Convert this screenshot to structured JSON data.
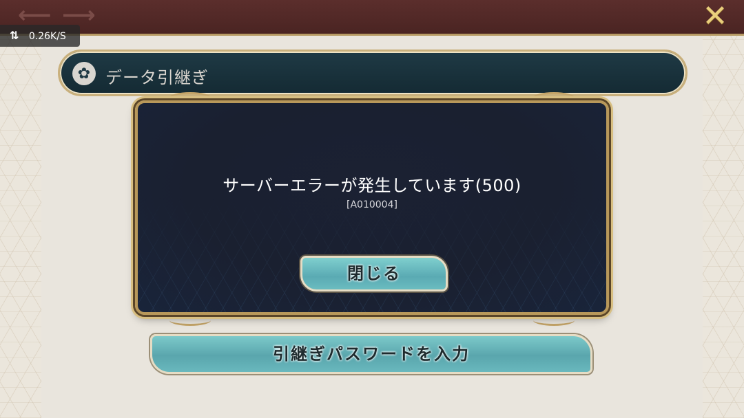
{
  "top_bar": {
    "back_icon": "arrow-left-icon",
    "back_glyph": "⟵",
    "forward_icon": "arrow-right-icon",
    "forward_glyph": "⟶",
    "close_icon": "close-x-icon",
    "close_glyph": "✕"
  },
  "network": {
    "icon": "transfer-arrows-icon",
    "glyph": "⇅",
    "speed": "0.26K/S"
  },
  "header": {
    "icon": "flower-emblem-icon",
    "icon_glyph": "✿",
    "title": "データ引継ぎ"
  },
  "dialog": {
    "message": "サーバーエラーが発生しています(500)",
    "code": "[A010004]",
    "close_label": "閉じる"
  },
  "actions": {
    "password_label": "引継ぎパスワードを入力"
  },
  "colors": {
    "top_bar": "#4a2422",
    "header_bg": "#142a33",
    "dialog_bg": "#1a2030",
    "button_teal": "#5aaab3",
    "gold_border": "#b8985a",
    "close_icon": "#e9cf7c"
  }
}
